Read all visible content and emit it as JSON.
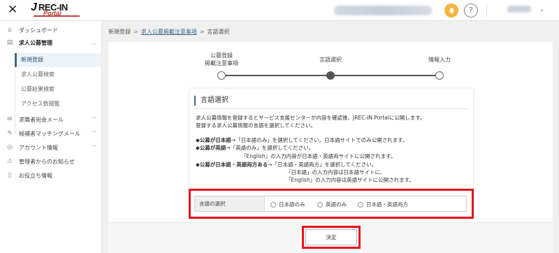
{
  "header": {
    "close_glyph": "✕",
    "logo": {
      "j": "J",
      "rec": "REC-IN",
      "portal": "Portal"
    },
    "help_glyph": "?",
    "account_chevron": "⌄"
  },
  "sidebar": {
    "items": [
      {
        "label": "ダッシュボード",
        "icon": "home-icon"
      },
      {
        "label": "求人公募管理",
        "icon": "job-icon"
      },
      {
        "label": "求職者宛会メール",
        "icon": "mail-icon"
      },
      {
        "label": "候補者マッチングメール",
        "icon": "match-icon"
      },
      {
        "label": "アカウント情報",
        "icon": "account-icon"
      },
      {
        "label": "管理者からのお知らせ",
        "icon": "warning-icon"
      },
      {
        "label": "お役立ち情報",
        "icon": "book-icon"
      }
    ],
    "subitems": [
      "新規登録",
      "求人公募検索",
      "公募結果検索",
      "アクセス数閲覧"
    ]
  },
  "breadcrumb": {
    "first": "新規登録",
    "second": "求人公募掲載注意事項",
    "third": "言語選択",
    "separator": ">"
  },
  "stepper": {
    "step1_line1": "公募登録",
    "step1_line2": "掲載注意事項",
    "step2": "言語選択",
    "step3": "情報入力",
    "current_step": 2
  },
  "card": {
    "title": "言語選択",
    "intro1": "求人公募情報を登録するとサービス支援センターが内容を確認後、JREC-IN Portalに公開します。",
    "intro2": "登録する求人公募情報の言語を選択してください。",
    "rule1_bold": "◆公募が日本語",
    "rule1_rest": "→「日本語のみ」を選択してください。日本語サイトでのみ公開されます。",
    "rule2_bold": "◆公募が英語",
    "rule2_rest": "→「英語のみ」を選択してください。",
    "rule2_note": "「English」の入力内容が日本語・英語両サイトに公開されます。",
    "rule3_bold": "◆公募が日本語・英語両方ある",
    "rule3_rest": "→「日本語・英語両方」を選択してください。",
    "rule3_note1": "「日本語」の入力内容は日本語サイトに、",
    "rule3_note2": "「English」の入力内容は英語サイトに公開されます。"
  },
  "language_select": {
    "label": "言語の選択",
    "options": [
      "日本語のみ",
      "英語のみ",
      "日本語・英語両方"
    ]
  },
  "submit_label": "決定",
  "colors": {
    "accent": "#3a6b8c",
    "highlight": "#e8141e",
    "bell": "#f4b63f"
  }
}
